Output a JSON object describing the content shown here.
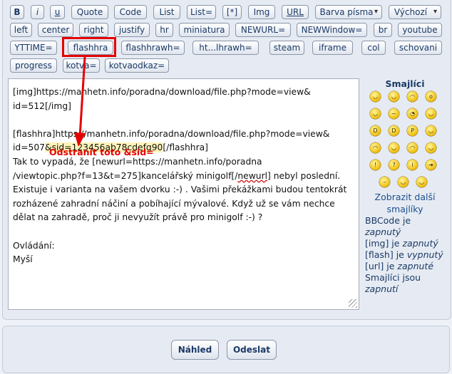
{
  "toolbar": {
    "buttons": [
      {
        "name": "b-button",
        "label": "B"
      },
      {
        "name": "i-button",
        "label": "i"
      },
      {
        "name": "u-button",
        "label": "u"
      },
      {
        "name": "quote-button",
        "label": "Quote"
      },
      {
        "name": "code-button",
        "label": "Code"
      },
      {
        "name": "list-button",
        "label": "List"
      },
      {
        "name": "list-eq-button",
        "label": "List="
      },
      {
        "name": "list-item-button",
        "label": "[*]"
      },
      {
        "name": "img-button",
        "label": "Img"
      },
      {
        "name": "url-button",
        "label": "URL"
      },
      {
        "name": "font-color-select",
        "label": "Barva písma"
      },
      {
        "name": "font-size-select",
        "label": "Výchozí"
      },
      {
        "name": "left-button",
        "label": "left"
      },
      {
        "name": "center-button",
        "label": "center"
      },
      {
        "name": "right-button",
        "label": "right"
      },
      {
        "name": "justify-button",
        "label": "justify"
      },
      {
        "name": "hr-button",
        "label": "hr"
      },
      {
        "name": "miniatura-button",
        "label": "miniatura"
      },
      {
        "name": "newurl-button",
        "label": "NEWURL="
      },
      {
        "name": "newwindow-button",
        "label": "NEWWindow="
      },
      {
        "name": "br-button",
        "label": "br"
      },
      {
        "name": "youtube-button",
        "label": "youtube"
      },
      {
        "name": "yttime-button",
        "label": "YTTIME="
      },
      {
        "name": "flashhra-button",
        "label": "flashhra"
      },
      {
        "name": "flashhrawh-button",
        "label": "flashhrawh="
      },
      {
        "name": "htmlhrawh-button",
        "label": "ht...lhrawh="
      },
      {
        "name": "steam-button",
        "label": "steam"
      },
      {
        "name": "iframe-button",
        "label": "iframe"
      },
      {
        "name": "col-button",
        "label": "col"
      },
      {
        "name": "schovani-button",
        "label": "schovani"
      },
      {
        "name": "progress-button",
        "label": "progress"
      },
      {
        "name": "kotva-button",
        "label": "kotva="
      },
      {
        "name": "kotvaodkaz-button",
        "label": "kotvaodkaz="
      }
    ]
  },
  "editor": {
    "line1": "[img]https://manhetn.info/poradna/download/file.php?mode=view&",
    "line2": "id=512[/img]",
    "line3": "",
    "line4": "[flashhra]https://manhetn.info/poradna/download/file.php?mode=view&",
    "line5a": "id=507",
    "line5hl": "&sid=123456ab78cdefg90",
    "line5b": "[/flashhra]",
    "line6a": "Tak to vypadá, že [newurl=https://manhetn.info/poradna",
    "line7a": "/viewtopic.php?f=13&t=275]kancelářský minigolf[/",
    "line7w": "newurl",
    "line7b": "] nebyl poslední.",
    "line8": "Existuje i varianta na vašem dvorku :-) . Vašimi překážkami budou tentokrát",
    "line9": "rozházené zahradní náčiní a pobíhající mývalové. Když už se vám nechce",
    "line10": "dělat na zahradě, proč ji nevyužít právě pro minigolf :-) ?",
    "line11": "",
    "line12": "Ovládání:",
    "line13": "Myší"
  },
  "annotation": {
    "text": "Odstranit toto &sid=",
    "color": "#e60000"
  },
  "smileys": {
    "title": "Smajlíci",
    "more_link": "Zobrazit další smajlíky",
    "items": [
      "smile",
      "happy",
      "sad",
      "surprised",
      "wink",
      "confused",
      "rolleyes",
      "cool",
      "laugh",
      "grin",
      "tongue",
      "embarrassed",
      "frown",
      "evil",
      "mad",
      "twisted",
      "exclaim",
      "question",
      "idea",
      "arrow",
      "neutral",
      "geek",
      "mr-green"
    ]
  },
  "status": {
    "bbcode": "BBCode je",
    "bbcode_state": "zapnutý",
    "img": "[img] je",
    "img_state": "zapnutý",
    "flash": "[flash] je",
    "flash_state": "vypnutý",
    "url": "[url] je",
    "url_state": "zapnuté",
    "smileys": "Smajlíci jsou",
    "smileys_state": "zapnutí"
  },
  "actions": {
    "preview": "Náhled",
    "submit": "Odeslat"
  }
}
